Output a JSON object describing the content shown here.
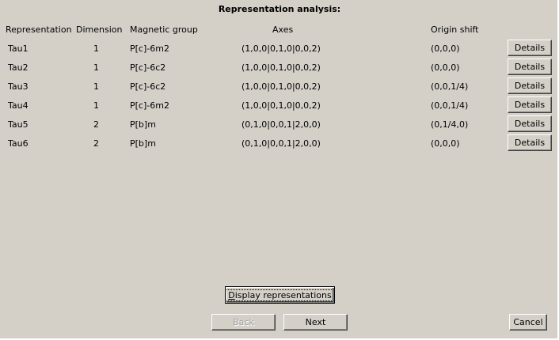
{
  "title": "Representation analysis:",
  "columns": {
    "representation": "Representation",
    "dimension": "Dimension",
    "magnetic_group": "Magnetic group",
    "axes": "Axes",
    "origin_shift": "Origin shift"
  },
  "rows": [
    {
      "representation": "Tau1",
      "dimension": "1",
      "magnetic_group": "P[c]-6m2",
      "axes": "(1,0,0|0,1,0|0,0,2)",
      "origin_shift": "(0,0,0)",
      "details": "Details"
    },
    {
      "representation": "Tau2",
      "dimension": "1",
      "magnetic_group": "P[c]-6c2",
      "axes": "(1,0,0|0,1,0|0,0,2)",
      "origin_shift": "(0,0,0)",
      "details": "Details"
    },
    {
      "representation": "Tau3",
      "dimension": "1",
      "magnetic_group": "P[c]-6c2",
      "axes": "(1,0,0|0,1,0|0,0,2)",
      "origin_shift": "(0,0,1/4)",
      "details": "Details"
    },
    {
      "representation": "Tau4",
      "dimension": "1",
      "magnetic_group": "P[c]-6m2",
      "axes": "(1,0,0|0,1,0|0,0,2)",
      "origin_shift": "(0,0,1/4)",
      "details": "Details"
    },
    {
      "representation": "Tau5",
      "dimension": "2",
      "magnetic_group": "P[b]m",
      "axes": "(0,1,0|0,0,1|2,0,0)",
      "origin_shift": "(0,1/4,0)",
      "details": "Details"
    },
    {
      "representation": "Tau6",
      "dimension": "2",
      "magnetic_group": "P[b]m",
      "axes": "(0,1,0|0,0,1|2,0,0)",
      "origin_shift": "(0,0,0)",
      "details": "Details"
    }
  ],
  "buttons": {
    "display_mnemonic": "D",
    "display_rest": "isplay representations",
    "back": "Back",
    "next": "Next",
    "cancel": "Cancel"
  }
}
